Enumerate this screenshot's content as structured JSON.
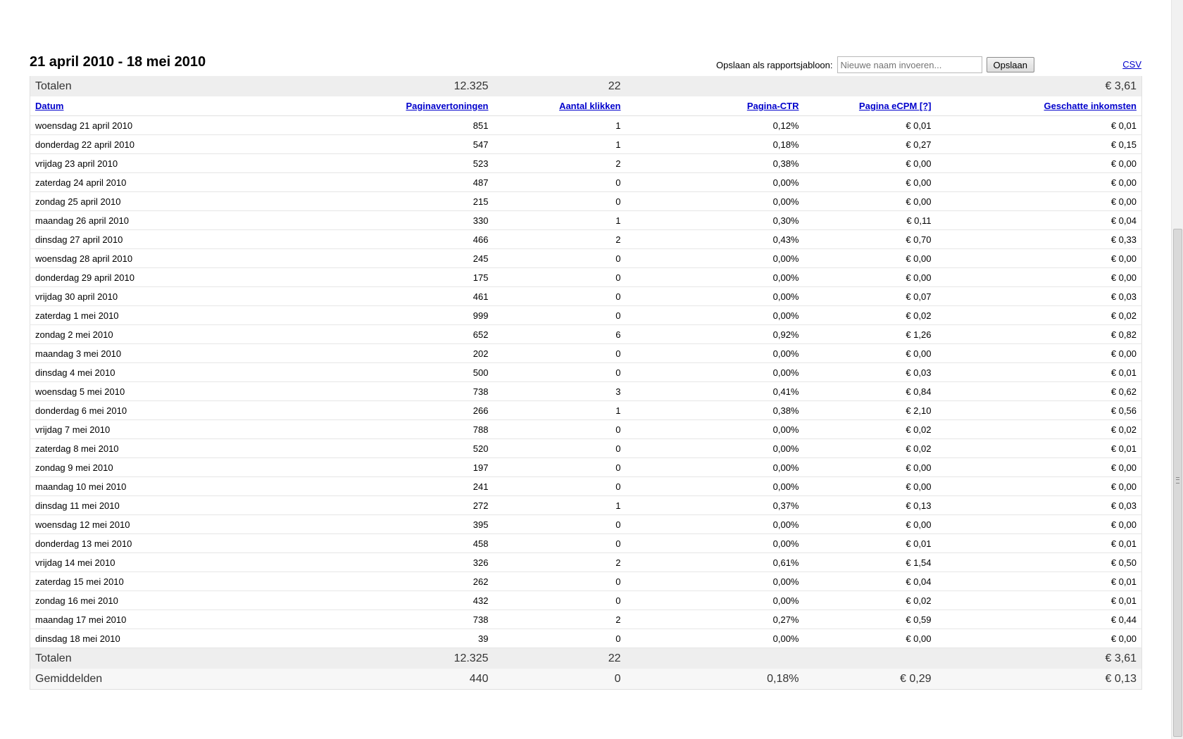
{
  "report": {
    "title": "21 april 2010 - 18 mei 2010",
    "save_label": "Opslaan als rapportsjabloon:",
    "save_placeholder": "Nieuwe naam invoeren...",
    "save_button": "Opslaan",
    "csv_link": "CSV"
  },
  "totals_top": [
    "Totalen",
    "12.325",
    "22",
    "",
    "",
    "€ 3,61"
  ],
  "columns": [
    "Datum",
    "Paginavertoningen",
    "Aantal klikken",
    "Pagina-CTR",
    "Pagina eCPM [?]",
    "Geschatte inkomsten"
  ],
  "rows": [
    [
      "woensdag 21 april 2010",
      "851",
      "1",
      "0,12%",
      "€ 0,01",
      "€ 0,01"
    ],
    [
      "donderdag 22 april 2010",
      "547",
      "1",
      "0,18%",
      "€ 0,27",
      "€ 0,15"
    ],
    [
      "vrijdag 23 april 2010",
      "523",
      "2",
      "0,38%",
      "€ 0,00",
      "€ 0,00"
    ],
    [
      "zaterdag 24 april 2010",
      "487",
      "0",
      "0,00%",
      "€ 0,00",
      "€ 0,00"
    ],
    [
      "zondag 25 april 2010",
      "215",
      "0",
      "0,00%",
      "€ 0,00",
      "€ 0,00"
    ],
    [
      "maandag 26 april 2010",
      "330",
      "1",
      "0,30%",
      "€ 0,11",
      "€ 0,04"
    ],
    [
      "dinsdag 27 april 2010",
      "466",
      "2",
      "0,43%",
      "€ 0,70",
      "€ 0,33"
    ],
    [
      "woensdag 28 april 2010",
      "245",
      "0",
      "0,00%",
      "€ 0,00",
      "€ 0,00"
    ],
    [
      "donderdag 29 april 2010",
      "175",
      "0",
      "0,00%",
      "€ 0,00",
      "€ 0,00"
    ],
    [
      "vrijdag 30 april 2010",
      "461",
      "0",
      "0,00%",
      "€ 0,07",
      "€ 0,03"
    ],
    [
      "zaterdag 1 mei 2010",
      "999",
      "0",
      "0,00%",
      "€ 0,02",
      "€ 0,02"
    ],
    [
      "zondag 2 mei 2010",
      "652",
      "6",
      "0,92%",
      "€ 1,26",
      "€ 0,82"
    ],
    [
      "maandag 3 mei 2010",
      "202",
      "0",
      "0,00%",
      "€ 0,00",
      "€ 0,00"
    ],
    [
      "dinsdag 4 mei 2010",
      "500",
      "0",
      "0,00%",
      "€ 0,03",
      "€ 0,01"
    ],
    [
      "woensdag 5 mei 2010",
      "738",
      "3",
      "0,41%",
      "€ 0,84",
      "€ 0,62"
    ],
    [
      "donderdag 6 mei 2010",
      "266",
      "1",
      "0,38%",
      "€ 2,10",
      "€ 0,56"
    ],
    [
      "vrijdag 7 mei 2010",
      "788",
      "0",
      "0,00%",
      "€ 0,02",
      "€ 0,02"
    ],
    [
      "zaterdag 8 mei 2010",
      "520",
      "0",
      "0,00%",
      "€ 0,02",
      "€ 0,01"
    ],
    [
      "zondag 9 mei 2010",
      "197",
      "0",
      "0,00%",
      "€ 0,00",
      "€ 0,00"
    ],
    [
      "maandag 10 mei 2010",
      "241",
      "0",
      "0,00%",
      "€ 0,00",
      "€ 0,00"
    ],
    [
      "dinsdag 11 mei 2010",
      "272",
      "1",
      "0,37%",
      "€ 0,13",
      "€ 0,03"
    ],
    [
      "woensdag 12 mei 2010",
      "395",
      "0",
      "0,00%",
      "€ 0,00",
      "€ 0,00"
    ],
    [
      "donderdag 13 mei 2010",
      "458",
      "0",
      "0,00%",
      "€ 0,01",
      "€ 0,01"
    ],
    [
      "vrijdag 14 mei 2010",
      "326",
      "2",
      "0,61%",
      "€ 1,54",
      "€ 0,50"
    ],
    [
      "zaterdag 15 mei 2010",
      "262",
      "0",
      "0,00%",
      "€ 0,04",
      "€ 0,01"
    ],
    [
      "zondag 16 mei 2010",
      "432",
      "0",
      "0,00%",
      "€ 0,02",
      "€ 0,01"
    ],
    [
      "maandag 17 mei 2010",
      "738",
      "2",
      "0,27%",
      "€ 0,59",
      "€ 0,44"
    ],
    [
      "dinsdag 18 mei 2010",
      "39",
      "0",
      "0,00%",
      "€ 0,00",
      "€ 0,00"
    ]
  ],
  "totals_bottom": [
    "Totalen",
    "12.325",
    "22",
    "",
    "",
    "€ 3,61"
  ],
  "averages": [
    "Gemiddelden",
    "440",
    "0",
    "0,18%",
    "€ 0,29",
    "€ 0,13"
  ]
}
